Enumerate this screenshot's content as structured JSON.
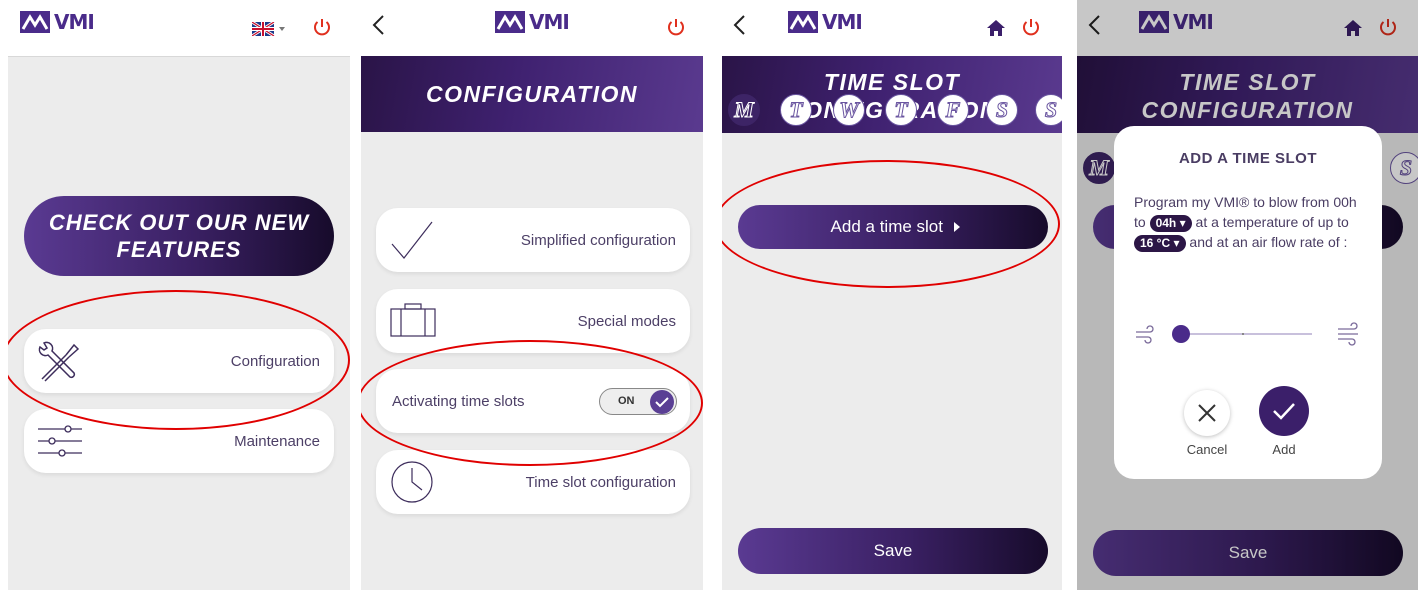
{
  "brand": {
    "logo_text": "VMI",
    "accent": "#3b1f6a",
    "power_color": "#e0301e",
    "annotation_color": "#e00000"
  },
  "screen1": {
    "language_icon": "uk-flag-icon",
    "banner": "CHECK OUT OUR NEW FEATURES",
    "menu": [
      {
        "label": "Configuration",
        "icon": "tools-icon"
      },
      {
        "label": "Maintenance",
        "icon": "sliders-icon"
      }
    ]
  },
  "screen2": {
    "title": "CONFIGURATION",
    "options": [
      {
        "label": "Simplified configuration",
        "icon": "checkmark-icon"
      },
      {
        "label": "Special modes",
        "icon": "suitcase-icon"
      }
    ],
    "toggle": {
      "label": "Activating time slots",
      "state": "ON"
    },
    "time_slot": {
      "label": "Time slot configuration",
      "icon": "clock-icon"
    }
  },
  "screen3": {
    "title_line1": "TIME SLOT",
    "title_line2": "CONFIGURATION",
    "days": [
      "M",
      "T",
      "W",
      "T",
      "F",
      "S",
      "S"
    ],
    "add_button": "Add a time slot",
    "save_button": "Save"
  },
  "screen4": {
    "modal_title": "ADD A TIME SLOT",
    "text_part1": "Program my VMI® to blow from 00h to",
    "hour_chip": "04h",
    "text_part2": "at a temperature of up to",
    "temp_chip": "16 °C",
    "text_part3": "and at an air flow rate of :",
    "airflow_level": 0,
    "cancel_label": "Cancel",
    "add_label": "Add",
    "save_button": "Save"
  }
}
